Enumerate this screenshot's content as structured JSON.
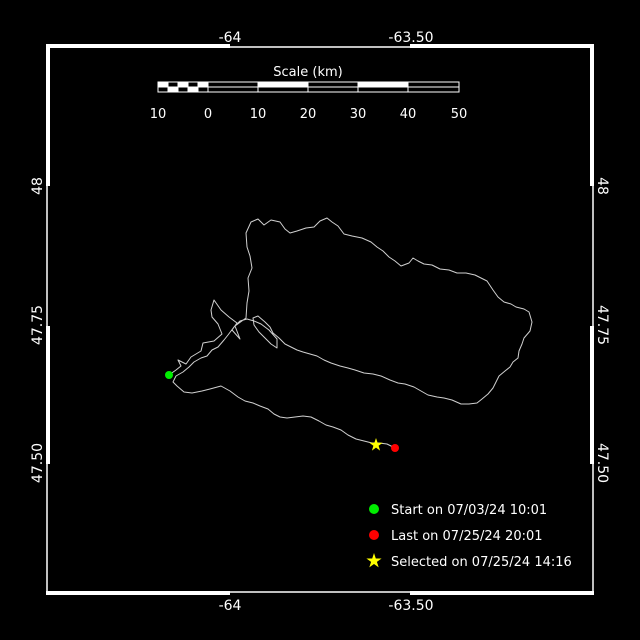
{
  "map": {
    "colors": {
      "background": "#000000",
      "frame": "#ffffff",
      "track": "#d0d0d0",
      "start": "#00ee00",
      "last": "#ff0000",
      "selected": "#ffff00"
    },
    "lon_labels": [
      "-64",
      "-63.50"
    ],
    "lat_labels": [
      "48",
      "47.75",
      "47.50"
    ],
    "scale_bar": {
      "title": "Scale (km)",
      "tick_labels": [
        "10",
        "0",
        "10",
        "20",
        "30",
        "40",
        "50"
      ]
    },
    "legend": [
      {
        "marker": "circle",
        "color": "#00ee00",
        "label": "Start on 07/03/24 10:01"
      },
      {
        "marker": "circle",
        "color": "#ff0000",
        "label": "Last on 07/25/24 20:01"
      },
      {
        "marker": "star",
        "color": "#ffff00",
        "label": "Selected on 07/25/24 14:16"
      }
    ]
  }
}
